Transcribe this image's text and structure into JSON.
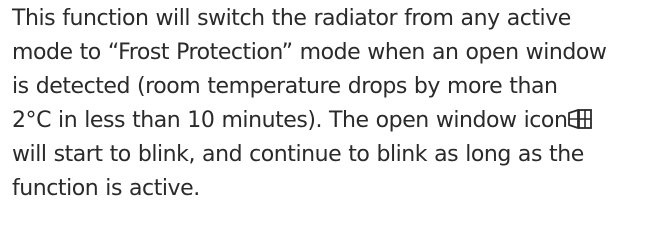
{
  "paragraph": {
    "lines": [
      "This function will switch the radiator from any active",
      "mode to “Frost Protection” mode when an open window",
      "is detected (room temperature drops by more than",
      "2°C in less than 10 minutes). The open window icon",
      "will start to blink, and continue to blink as long as the",
      "function is active."
    ],
    "inline_icon": "open-window-icon"
  }
}
